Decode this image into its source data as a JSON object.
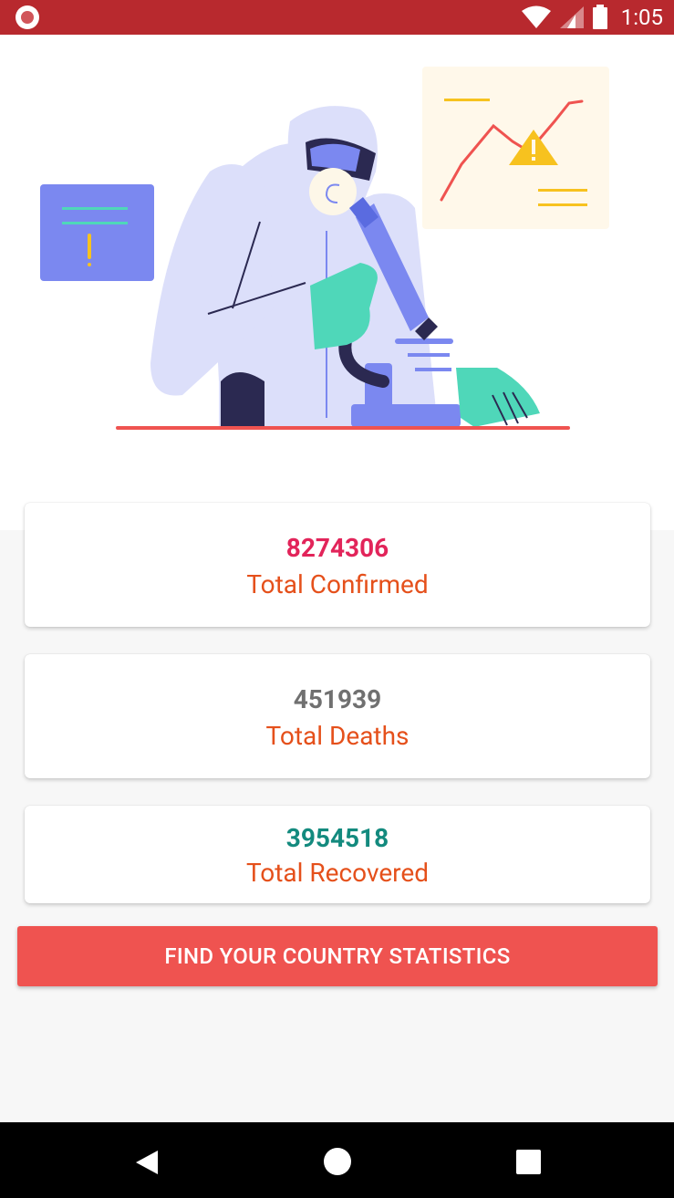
{
  "status_bar": {
    "time": "1:05",
    "icons": [
      "record-icon",
      "wifi-icon",
      "signal-icon",
      "battery-icon"
    ]
  },
  "hero": {
    "illustration": "scientist-with-microscope-illustration"
  },
  "stats": {
    "confirmed": {
      "value": "8274306",
      "label": "Total Confirmed",
      "color": "#e2245a"
    },
    "deaths": {
      "value": "451939",
      "label": "Total Deaths",
      "color": "#707070"
    },
    "recovered": {
      "value": "3954518",
      "label": "Total Recovered",
      "color": "#138a7e"
    },
    "label_color": "#e5501b"
  },
  "actions": {
    "find_country_label": "FIND YOUR COUNTRY STATISTICS",
    "button_color": "#ef5350"
  },
  "nav_bar": {
    "icons": [
      "back-icon",
      "home-icon",
      "recents-icon"
    ]
  }
}
